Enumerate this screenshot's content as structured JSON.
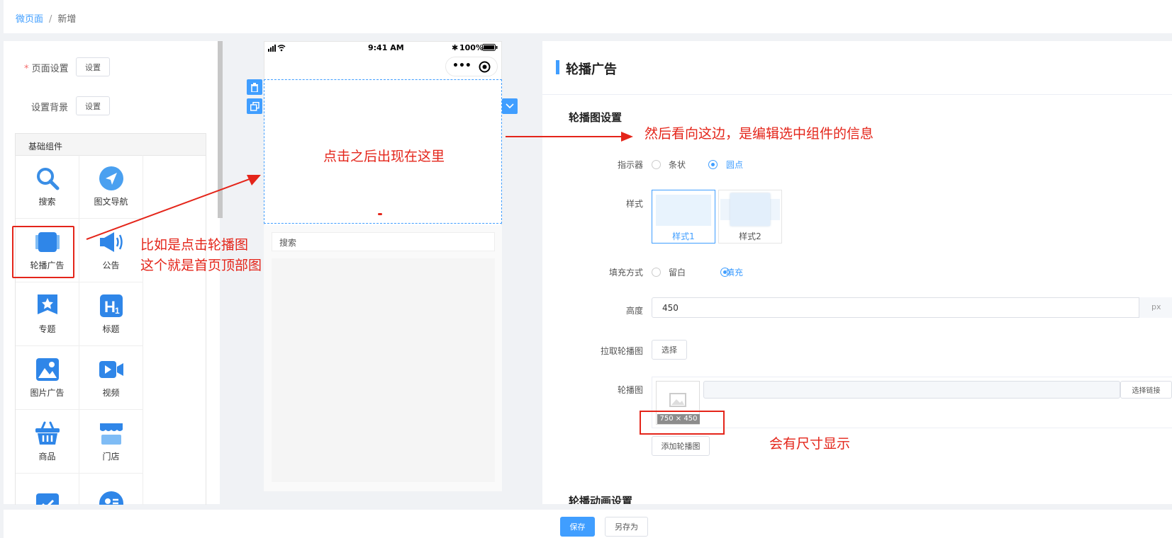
{
  "breadcrumb": {
    "parent": "微页面",
    "separator": "/",
    "current": "新增"
  },
  "left_panel": {
    "page_settings_label": "页面设置",
    "page_settings_btn": "设置",
    "bg_settings_label": "设置背景",
    "bg_settings_btn": "设置",
    "basic_components_title": "基础组件",
    "components": [
      {
        "label": "搜索",
        "icon": "search-icon"
      },
      {
        "label": "图文导航",
        "icon": "navigation-icon"
      },
      {
        "label": "轮播广告",
        "icon": "carousel-icon"
      },
      {
        "label": "公告",
        "icon": "megaphone-icon"
      },
      {
        "label": "专题",
        "icon": "topic-icon"
      },
      {
        "label": "标题",
        "icon": "heading-icon"
      },
      {
        "label": "图片广告",
        "icon": "image-icon"
      },
      {
        "label": "视频",
        "icon": "video-icon"
      },
      {
        "label": "商品",
        "icon": "basket-icon"
      },
      {
        "label": "门店",
        "icon": "store-icon"
      }
    ]
  },
  "phone": {
    "time": "9:41 AM",
    "battery": "100%",
    "search_placeholder": "搜索"
  },
  "right_panel": {
    "title": "轮播广告",
    "section_title": "轮播图设置",
    "indicator_label": "指示器",
    "indicator_options": [
      "条状",
      "圆点"
    ],
    "style_label": "样式",
    "style_options": [
      "样式1",
      "样式2"
    ],
    "fill_label": "填充方式",
    "fill_options": [
      "留白",
      "填充"
    ],
    "height_label": "高度",
    "height_value": "450",
    "height_unit": "px",
    "pull_label": "拉取轮播图",
    "pull_btn": "选择",
    "carousel_label": "轮播图",
    "image_size": "750 × 450",
    "link_btn": "选择链接",
    "add_btn": "添加轮播图",
    "anim_section_title": "轮播动画设置"
  },
  "annotations": {
    "left": "比如是点击轮播图\n这个就是首页顶部图",
    "middle": "点击之后出现在这里",
    "right": "然后看向这边，是编辑选中组件的信息",
    "size": "会有尺寸显示"
  },
  "footer": {
    "save": "保存",
    "save_as": "另存为"
  },
  "colors": {
    "accent": "#409eff",
    "annotation": "#e4251a"
  }
}
